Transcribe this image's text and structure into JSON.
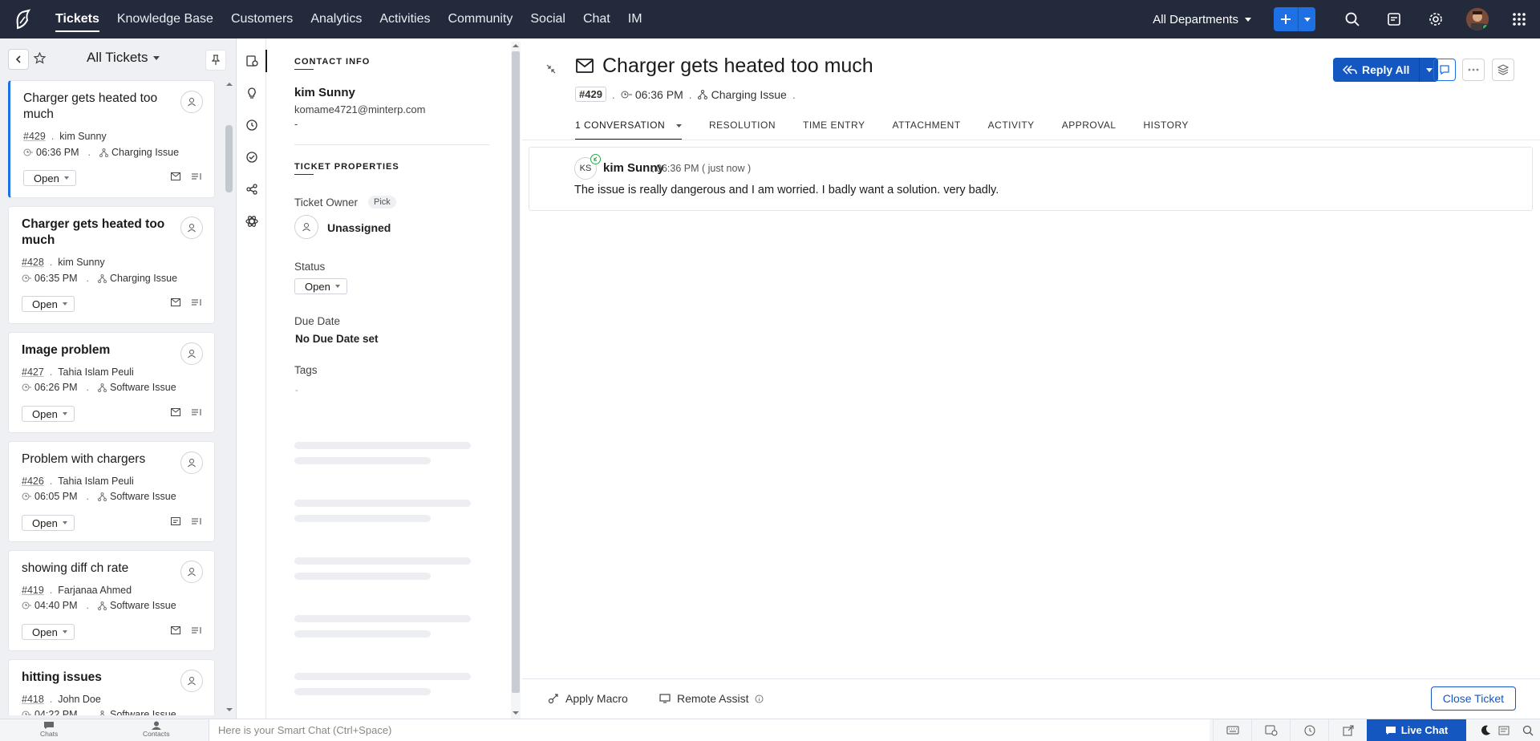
{
  "nav": {
    "tabs": [
      "Tickets",
      "Knowledge Base",
      "Customers",
      "Analytics",
      "Activities",
      "Community",
      "Social",
      "Chat",
      "IM"
    ],
    "department": "All Departments"
  },
  "list": {
    "title": "All Tickets",
    "tickets": [
      {
        "subject": "Charger gets heated too much",
        "number": "#429",
        "contact": "kim Sunny",
        "time": "06:36 PM",
        "category": "Charging Issue",
        "status": "Open"
      },
      {
        "subject": "Charger gets heated too much",
        "number": "#428",
        "contact": "kim Sunny",
        "time": "06:35 PM",
        "category": "Charging Issue",
        "status": "Open"
      },
      {
        "subject": "Image problem",
        "number": "#427",
        "contact": "Tahia Islam Peuli",
        "time": "06:26 PM",
        "category": "Software Issue",
        "status": "Open"
      },
      {
        "subject": "Problem with chargers",
        "number": "#426",
        "contact": "Tahia Islam Peuli",
        "time": "06:05 PM",
        "category": "Software Issue",
        "status": "Open"
      },
      {
        "subject": "showing diff ch rate",
        "number": "#419",
        "contact": "Farjanaa Ahmed",
        "time": "04:40 PM",
        "category": "Software Issue",
        "status": "Open"
      },
      {
        "subject": "hitting issues",
        "number": "#418",
        "contact": "John Doe",
        "time": "04:22 PM",
        "category": "Software Issue",
        "status": "Open"
      }
    ]
  },
  "props": {
    "contact_header": "CONTACT INFO",
    "contact_name": "kim Sunny",
    "contact_email": "komame4721@minterp.com",
    "contact_phone": "-",
    "ticket_header": "TICKET PROPERTIES",
    "owner_label": "Ticket Owner",
    "pick_label": "Pick",
    "owner_value": "Unassigned",
    "status_label": "Status",
    "status_value": "Open",
    "due_label": "Due Date",
    "due_value": "No Due Date set",
    "tags_label": "Tags",
    "tags_value": "-"
  },
  "detail": {
    "title": "Charger gets heated too much",
    "number": "#429",
    "time": "06:36 PM",
    "category": "Charging Issue",
    "reply_label": "Reply All",
    "tabs": [
      "1 CONVERSATION",
      "RESOLUTION",
      "TIME ENTRY",
      "ATTACHMENT",
      "ACTIVITY",
      "APPROVAL",
      "HISTORY"
    ],
    "thread": {
      "initials": "KS",
      "author": "kim Sunny",
      "time": "06:36 PM ( just now )",
      "message": "The issue is really dangerous and I am worried. I badly want a solution. very badly."
    },
    "footer": {
      "macro": "Apply Macro",
      "remote": "Remote Assist",
      "close": "Close Ticket"
    }
  },
  "bottom": {
    "chats": "Chats",
    "contacts": "Contacts",
    "smartchat_placeholder": "Here is your Smart Chat (Ctrl+Space)",
    "livechat": "Live Chat"
  },
  "colors": {
    "nav_bg": "#222a3b",
    "accent": "#1e70e5",
    "reply": "#1557c0"
  }
}
